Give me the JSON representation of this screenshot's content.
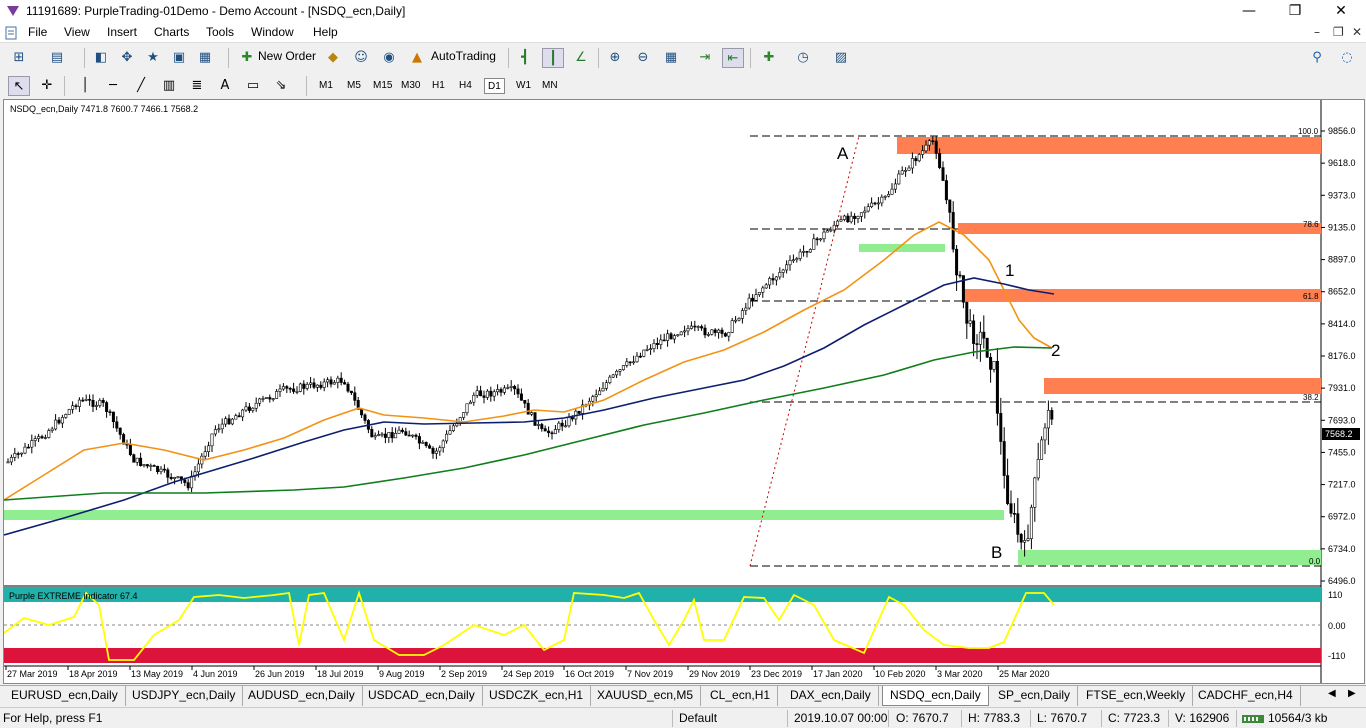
{
  "window": {
    "title": "11191689: PurpleTrading-01Demo - Demo Account - [NSDQ_ecn,Daily]",
    "minimize_glyph": "—",
    "maximize_glyph": "❐",
    "close_glyph": "✕"
  },
  "menu": {
    "items": [
      "File",
      "View",
      "Insert",
      "Charts",
      "Tools",
      "Window",
      "Help"
    ],
    "mdi_minimize": "–",
    "mdi_restore": "❐",
    "mdi_close": "✕"
  },
  "toolbar": {
    "new_order_label": "New Order",
    "autotrading_label": "AutoTrading",
    "draw_label_A": "A",
    "timeframes": [
      "M1",
      "M5",
      "M15",
      "M30",
      "H1",
      "H4",
      "D1",
      "W1",
      "MN"
    ],
    "active_timeframe": "D1"
  },
  "chart": {
    "header": "NSDQ_ecn,Daily  7471.8 7600.7 7466.1 7568.2",
    "current_price": "7568.2",
    "price_labels": [
      "9856.0",
      "9618.0",
      "9373.0",
      "9135.0",
      "8897.0",
      "8652.0",
      "8414.0",
      "8176.0",
      "7931.0",
      "7693.0",
      "7455.0",
      "7217.0",
      "6972.0",
      "6734.0",
      "6496.0"
    ],
    "date_labels": [
      "27 Mar 2019",
      "18 Apr 2019",
      "13 May 2019",
      "4 Jun 2019",
      "26 Jun 2019",
      "18 Jul 2019",
      "9 Aug 2019",
      "2 Sep 2019",
      "24 Sep 2019",
      "16 Oct 2019",
      "7 Nov 2019",
      "29 Nov 2019",
      "23 Dec 2019",
      "17 Jan 2020",
      "10 Feb 2020",
      "3 Mar 2020",
      "25 Mar 2020"
    ],
    "fib_levels": [
      "100.0",
      "78.6",
      "61.8",
      "38.2",
      "0.0"
    ],
    "annotations": {
      "A": "A",
      "B": "B",
      "one": "1",
      "two": "2"
    },
    "colors": {
      "up": "#ffffff",
      "candle": "#000000",
      "ma_fast": "#f39212",
      "ma_mid": "#0e1e6e",
      "ma_slow": "#0f7d1a",
      "resistance": "#ff7f50",
      "support": "#90ee90",
      "osc": "#ffff00",
      "osc_high": "#20b2aa",
      "osc_low": "#dc143c"
    }
  },
  "indicator": {
    "label": "Purple EXTREME indicator 67.4",
    "levels": [
      "110",
      "0.00",
      "-110"
    ]
  },
  "tabs": [
    "EURUSD_ecn,Daily",
    "USDJPY_ecn,Daily",
    "AUDUSD_ecn,Daily",
    "USDCAD_ecn,Daily",
    "USDCZK_ecn,H1",
    "XAUUSD_ecn,M5",
    "CL_ecn,H1",
    "DAX_ecn,Daily",
    "NSDQ_ecn,Daily",
    "SP_ecn,Daily",
    "FTSE_ecn,Weekly",
    "CADCHF_ecn,H4"
  ],
  "active_tab": "NSDQ_ecn,Daily",
  "status": {
    "help": "For Help, press F1",
    "profile": "Default",
    "datetime": "2019.10.07 00:00",
    "open": "O: 7670.7",
    "high": "H: 7783.3",
    "low": "L: 7670.7",
    "close": "C: 7723.3",
    "volume": "V: 162906",
    "traffic": "10564/3 kb"
  }
}
